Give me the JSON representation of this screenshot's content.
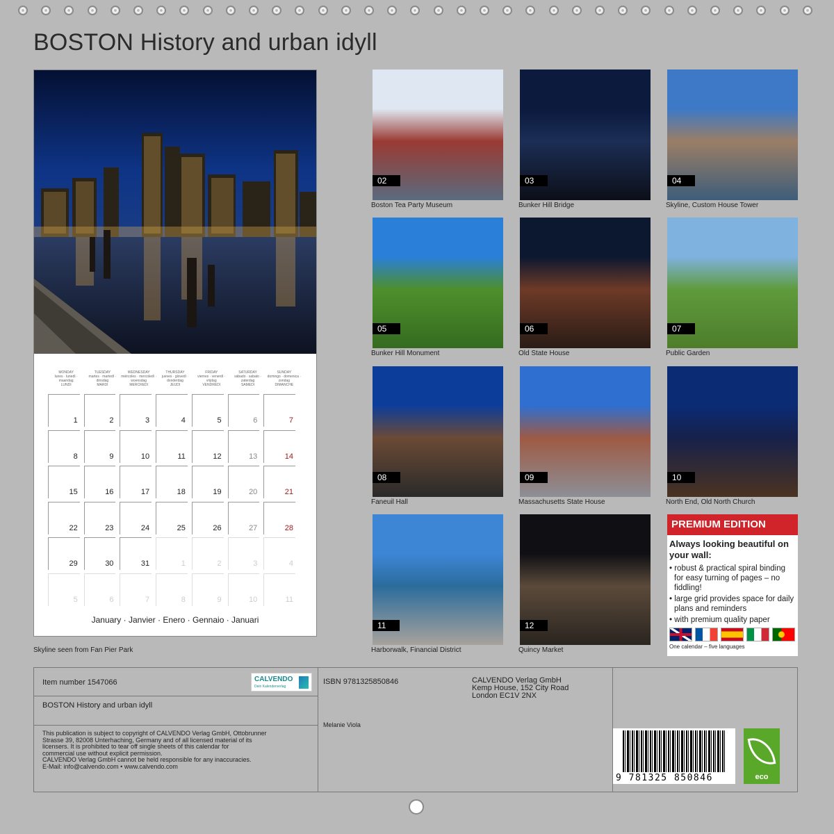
{
  "title": "BOSTON History and urban idyll",
  "cover_caption": "Skyline seen from Fan Pier Park",
  "calendar": {
    "weekdays": [
      {
        "en": "MONDAY",
        "langs": "lunes · lunedì · maandag",
        "fr": "LUNDI"
      },
      {
        "en": "TUESDAY",
        "langs": "martes · martedì · dinsdag",
        "fr": "MARDI"
      },
      {
        "en": "WEDNESDAY",
        "langs": "miércoles · mercoledì · woensdag",
        "fr": "MERCREDI"
      },
      {
        "en": "THURSDAY",
        "langs": "jueves · giovedì · donderdag",
        "fr": "JEUDI"
      },
      {
        "en": "FRIDAY",
        "langs": "viernes · venerdì · vrijdag",
        "fr": "VENDREDI"
      },
      {
        "en": "SATURDAY",
        "langs": "sábado · sabato · zaterdag",
        "fr": "SAMEDI"
      },
      {
        "en": "SUNDAY",
        "langs": "domingo · domenica · zondag",
        "fr": "DIMANCHE"
      }
    ],
    "weeks": [
      [
        "1",
        "2",
        "3",
        "4",
        "5",
        "6",
        "7"
      ],
      [
        "8",
        "9",
        "10",
        "11",
        "12",
        "13",
        "14"
      ],
      [
        "15",
        "16",
        "17",
        "18",
        "19",
        "20",
        "21"
      ],
      [
        "22",
        "23",
        "24",
        "25",
        "26",
        "27",
        "28"
      ],
      [
        "29",
        "30",
        "31",
        "1",
        "2",
        "3",
        "4"
      ],
      [
        "5",
        "6",
        "7",
        "8",
        "9",
        "10",
        "11"
      ]
    ],
    "month": "January · Janvier · Enero · Gennaio · Januari"
  },
  "thumbs": [
    {
      "num": "02",
      "caption": "Boston Tea Party Museum",
      "colors": [
        "#dfe8f2",
        "#9a3a33",
        "#5a6b7e"
      ]
    },
    {
      "num": "03",
      "caption": "Bunker Hill Bridge",
      "colors": [
        "#0b1a3d",
        "#1c2e55",
        "#0c0f18"
      ]
    },
    {
      "num": "04",
      "caption": "Skyline, Custom House Tower",
      "colors": [
        "#3d79c6",
        "#9a7e66",
        "#3e5d7a"
      ]
    },
    {
      "num": "05",
      "caption": "Bunker Hill Monument",
      "colors": [
        "#2a7fd9",
        "#4e8f2c",
        "#356b20"
      ]
    },
    {
      "num": "06",
      "caption": "Old State House",
      "colors": [
        "#0c1730",
        "#6e3a27",
        "#2a1c16"
      ]
    },
    {
      "num": "07",
      "caption": "Public Garden",
      "colors": [
        "#7fb2df",
        "#5f9b3c",
        "#4e7d2a"
      ]
    },
    {
      "num": "08",
      "caption": "Faneuil Hall",
      "colors": [
        "#0d3d9a",
        "#6b4a36",
        "#2a2a2a"
      ]
    },
    {
      "num": "09",
      "caption": "Massachusetts State House",
      "colors": [
        "#2f6fd0",
        "#9e5a44",
        "#8d8f96"
      ]
    },
    {
      "num": "10",
      "caption": "North End, Old North Church",
      "colors": [
        "#0b2b74",
        "#17214a",
        "#4b3320"
      ]
    },
    {
      "num": "11",
      "caption": "Harborwalk, Financial District",
      "colors": [
        "#3d86d6",
        "#2b6c9c",
        "#a7a29c"
      ]
    },
    {
      "num": "12",
      "caption": "Quincy Market",
      "colors": [
        "#0f0f14",
        "#5b4a3a",
        "#2a2520"
      ]
    }
  ],
  "premium": {
    "band": "PREMIUM EDITION",
    "title": "Always looking beautiful on your wall:",
    "items": [
      "• robust & practical spiral binding for easy turning of pages – no fiddling!",
      "• large grid provides space for daily plans and reminders",
      "• with premium quality paper"
    ],
    "footer": "One calendar – five languages"
  },
  "info": {
    "item_number": "Item number 1547066",
    "title": "BOSTON History and urban idyll",
    "legal": [
      "This publication is subject to copyright of CALVENDO Verlag GmbH, Ottobrunner",
      "Strasse 39, 82008 Unterhaching, Germany and of all licensed material of its",
      "licensers. It is prohibited to tear off single sheets of this calendar for",
      "commercial use without explicit permission.",
      "CALVENDO Verlag GmbH cannot be held responsible for any inaccuracies.",
      "E-Mail: info@calvendo.com • www.calvendo.com"
    ],
    "isbn": "ISBN 9781325850846",
    "author": "Melanie Viola",
    "publisher": [
      "CALVENDO Verlag GmbH",
      "Kemp House, 152 City Road",
      "London EC1V 2NX"
    ],
    "logo_text": "CALVENDO",
    "logo_sub": "Dein Kalenderverlag",
    "barcode_number": "9 781325 850846",
    "eco": "eco"
  }
}
